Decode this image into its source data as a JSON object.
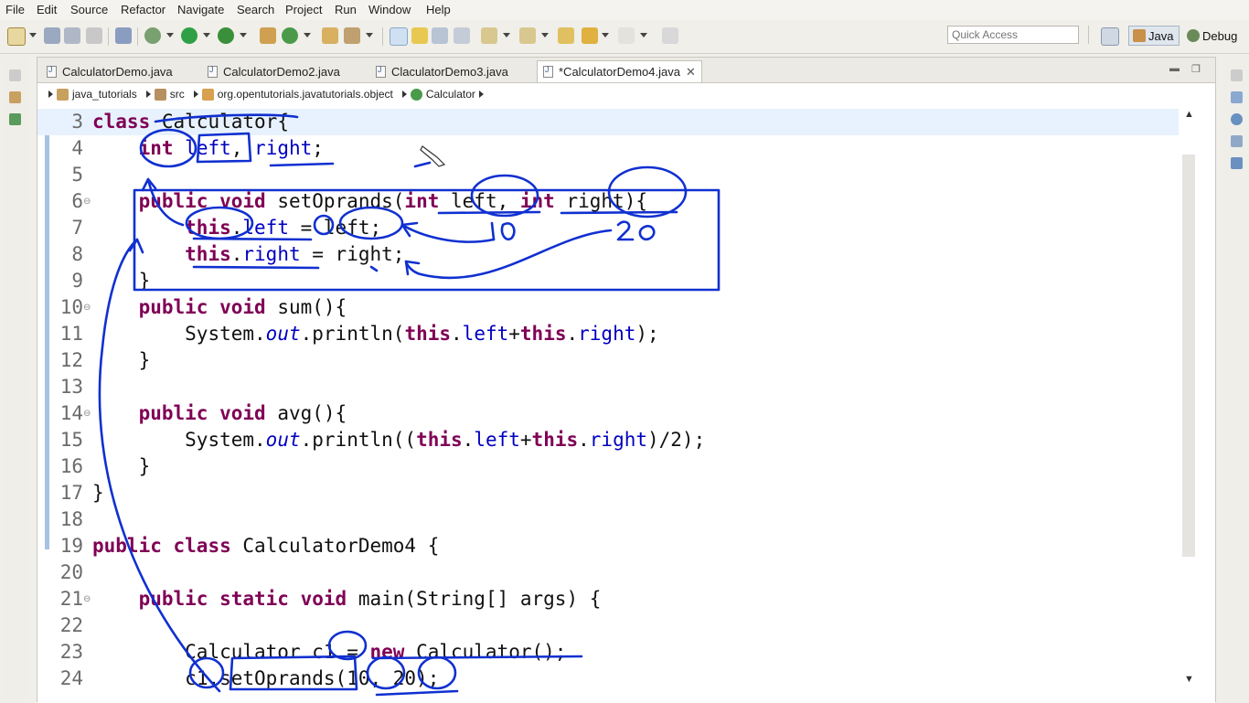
{
  "menu": [
    "File",
    "Edit",
    "Source",
    "Refactor",
    "Navigate",
    "Search",
    "Project",
    "Run",
    "Window",
    "Help"
  ],
  "quick_access": {
    "placeholder": "Quick Access"
  },
  "perspectives": {
    "java": "Java",
    "debug": "Debug"
  },
  "tabs": [
    {
      "label": "CalculatorDemo.java"
    },
    {
      "label": "CalculatorDemo2.java"
    },
    {
      "label": "ClaculatorDemo3.java"
    },
    {
      "label": "*CalculatorDemo4.java",
      "active": true
    }
  ],
  "breadcrumb": [
    "java_tutorials",
    "src",
    "org.opentutorials.javatutorials.object",
    "Calculator"
  ],
  "code_lines": [
    {
      "n": "3",
      "text": "class Calculator{"
    },
    {
      "n": "4",
      "text": "    int left, right;"
    },
    {
      "n": "5",
      "text": ""
    },
    {
      "n": "6",
      "text": "    public void setOprands(int left, int right){"
    },
    {
      "n": "7",
      "text": "        this.left = left;"
    },
    {
      "n": "8",
      "text": "        this.right = right;"
    },
    {
      "n": "9",
      "text": "    }"
    },
    {
      "n": "10",
      "text": "    public void sum(){"
    },
    {
      "n": "11",
      "text": "        System.out.println(this.left+this.right);"
    },
    {
      "n": "12",
      "text": "    }"
    },
    {
      "n": "13",
      "text": ""
    },
    {
      "n": "14",
      "text": "    public void avg(){"
    },
    {
      "n": "15",
      "text": "        System.out.println((this.left+this.right)/2);"
    },
    {
      "n": "16",
      "text": "    }"
    },
    {
      "n": "17",
      "text": "}"
    },
    {
      "n": "18",
      "text": ""
    },
    {
      "n": "19",
      "text": "public class CalculatorDemo4 {"
    },
    {
      "n": "20",
      "text": ""
    },
    {
      "n": "21",
      "text": "    public static void main(String[] args) {"
    },
    {
      "n": "22",
      "text": ""
    },
    {
      "n": "23",
      "text": "        Calculator c1 = new Calculator();"
    },
    {
      "n": "24",
      "text": "        c1.setOprands(10, 20);"
    }
  ],
  "handwriting": {
    "a": "10",
    "b": "20"
  },
  "colors": {
    "keyword": "#7f0055",
    "field": "#0000c0",
    "annotation": "#1030d0",
    "current_line": "#e8f2fe"
  }
}
